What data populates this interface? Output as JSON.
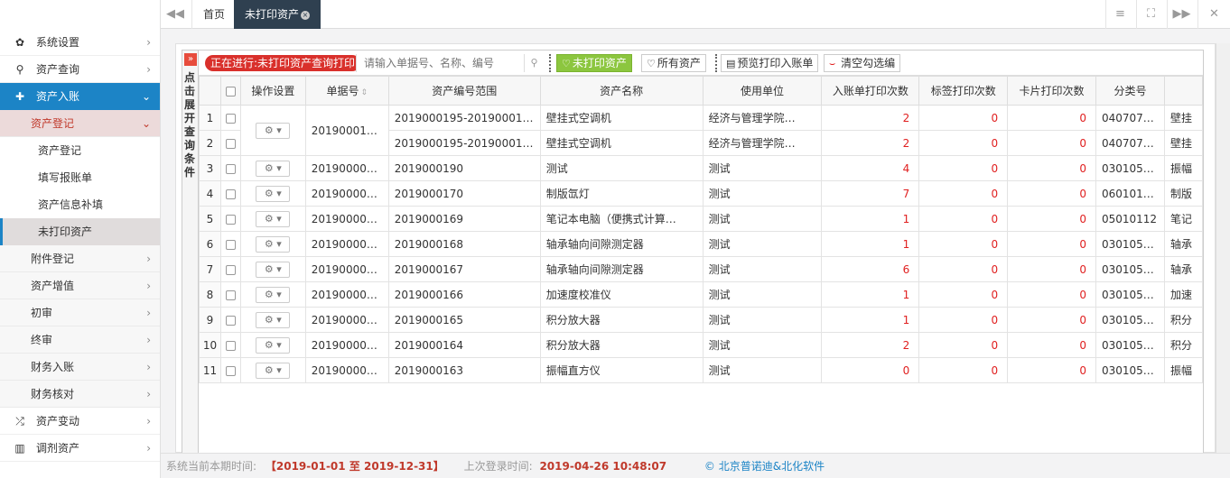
{
  "sidebar": {
    "items": [
      {
        "label": "系统设置",
        "icon": "gear-icon",
        "glyph": "✿"
      },
      {
        "label": "资产查询",
        "icon": "search-icon",
        "glyph": "🔍"
      },
      {
        "label": "资产入账",
        "icon": "plus-icon",
        "glyph": "✚"
      },
      {
        "label": "资产登记"
      },
      {
        "label": "资产登记"
      },
      {
        "label": "填写报账单"
      },
      {
        "label": "资产信息补填"
      },
      {
        "label": "未打印资产"
      },
      {
        "label": "附件登记"
      },
      {
        "label": "资产增值"
      },
      {
        "label": "初审"
      },
      {
        "label": "终审"
      },
      {
        "label": "财务入账"
      },
      {
        "label": "财务核对"
      },
      {
        "label": "资产变动",
        "icon": "shuffle-icon",
        "glyph": "⤨"
      },
      {
        "label": "调剂资产",
        "icon": "trash-icon",
        "glyph": "🗑"
      }
    ]
  },
  "tabs": {
    "home": "首页",
    "current": "未打印资产"
  },
  "toolbar": {
    "status": "正在进行:未打印资产查询打印",
    "search_placeholder": "请输入单据号、名称、编号",
    "btn_unprinted": "未打印资产",
    "btn_all": "所有资产",
    "btn_preview": "预览打印入账单",
    "btn_clear": "清空勾选编"
  },
  "query_strip": {
    "label": "点击展开查询条件"
  },
  "table": {
    "headers": {
      "op": "操作设置",
      "doc": "单据号",
      "range": "资产编号范围",
      "name": "资产名称",
      "unit": "使用单位",
      "entry_print": "入账单打印次数",
      "label_print": "标签打印次数",
      "card_print": "卡片打印次数",
      "category": "分类号",
      "extra": ""
    },
    "rows": [
      {
        "n": "1",
        "doc": "20190001…",
        "range": "2019000195-20190001…",
        "name": "壁挂式空调机",
        "unit": "经济与管理学院…",
        "entry": "2",
        "label": "0",
        "card": "0",
        "cat": "040707…",
        "extra": "壁挂"
      },
      {
        "n": "2",
        "doc": "",
        "range": "2019000195-20190001…",
        "name": "壁挂式空调机",
        "unit": "经济与管理学院…",
        "entry": "2",
        "label": "0",
        "card": "0",
        "cat": "040707…",
        "extra": "壁挂"
      },
      {
        "n": "3",
        "doc": "20190000…",
        "range": "2019000190",
        "name": "测试",
        "unit": "测试",
        "entry": "4",
        "label": "0",
        "card": "0",
        "cat": "030105…",
        "extra": "振幅"
      },
      {
        "n": "4",
        "doc": "20190000…",
        "range": "2019000170",
        "name": "制版氙灯",
        "unit": "测试",
        "entry": "7",
        "label": "0",
        "card": "0",
        "cat": "060101…",
        "extra": "制版"
      },
      {
        "n": "5",
        "doc": "20190000…",
        "range": "2019000169",
        "name": "笔记本电脑（便携式计算…",
        "unit": "测试",
        "entry": "1",
        "label": "0",
        "card": "0",
        "cat": "05010112",
        "extra": "笔记"
      },
      {
        "n": "6",
        "doc": "20190000…",
        "range": "2019000168",
        "name": "轴承轴向间隙测定器",
        "unit": "测试",
        "entry": "1",
        "label": "0",
        "card": "0",
        "cat": "030105…",
        "extra": "轴承"
      },
      {
        "n": "7",
        "doc": "20190000…",
        "range": "2019000167",
        "name": "轴承轴向间隙测定器",
        "unit": "测试",
        "entry": "6",
        "label": "0",
        "card": "0",
        "cat": "030105…",
        "extra": "轴承"
      },
      {
        "n": "8",
        "doc": "20190000…",
        "range": "2019000166",
        "name": "加速度校准仪",
        "unit": "测试",
        "entry": "1",
        "label": "0",
        "card": "0",
        "cat": "030105…",
        "extra": "加速"
      },
      {
        "n": "9",
        "doc": "20190000…",
        "range": "2019000165",
        "name": "积分放大器",
        "unit": "测试",
        "entry": "1",
        "label": "0",
        "card": "0",
        "cat": "030105…",
        "extra": "积分"
      },
      {
        "n": "10",
        "doc": "20190000…",
        "range": "2019000164",
        "name": "积分放大器",
        "unit": "测试",
        "entry": "2",
        "label": "0",
        "card": "0",
        "cat": "030105…",
        "extra": "积分"
      },
      {
        "n": "11",
        "doc": "20190000…",
        "range": "2019000163",
        "name": "振幅直方仪",
        "unit": "测试",
        "entry": "0",
        "label": "0",
        "card": "0",
        "cat": "030105…",
        "extra": "振幅"
      }
    ]
  },
  "footer": {
    "period_label": "系统当前本期时间:",
    "period_value": "【2019-01-01 至 2019-12-31】",
    "login_label": "上次登录时间:",
    "login_value": "2019-04-26 10:48:07",
    "company": "© 北京普诺迪&北化软件"
  },
  "colors": {
    "sidebar_active": "#1c84c6",
    "tab_current": "#2f4050",
    "status_pill": "#d9302b",
    "green_button": "#8cc63f",
    "count_red": "#e02020"
  }
}
